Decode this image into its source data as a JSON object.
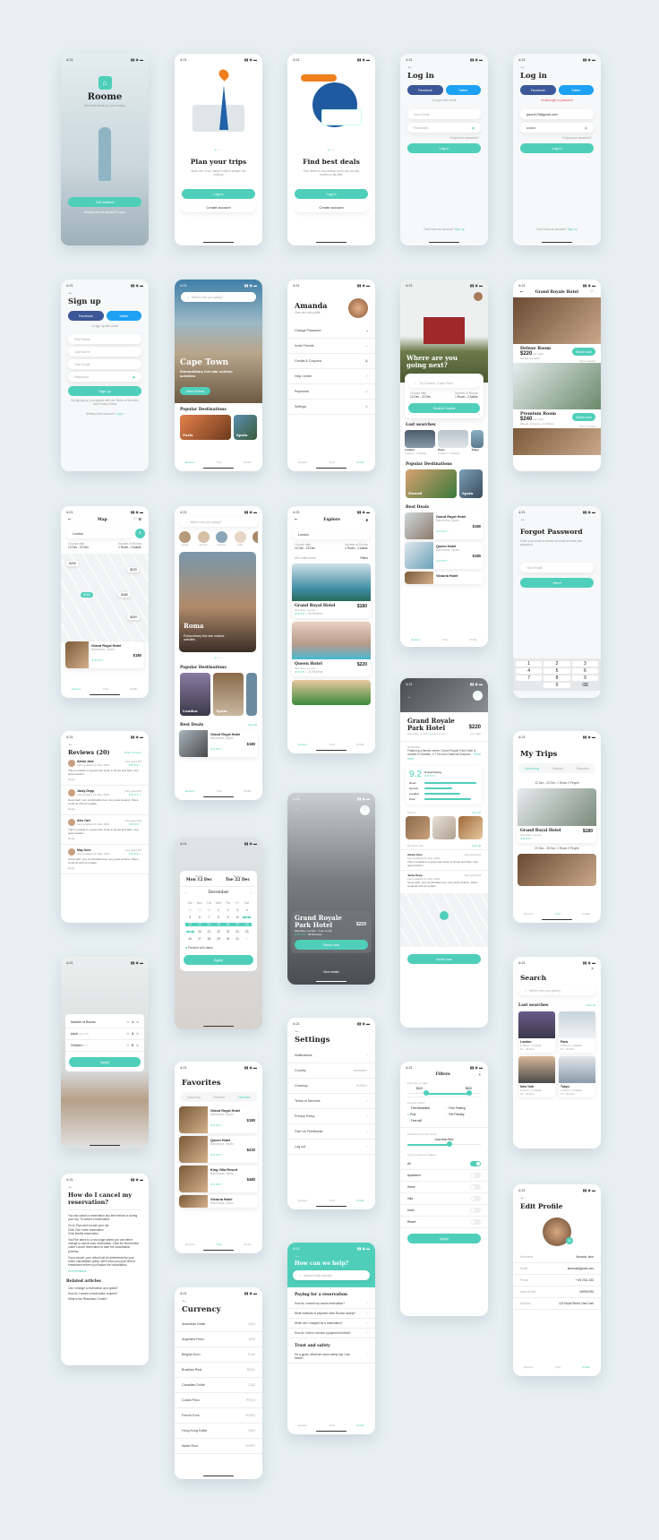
{
  "app": {
    "name": "Roome",
    "tagline": "Best hotel deals for your holiday",
    "status_time": "4:21",
    "accent": "#4fcfba",
    "facebook_color": "#3b5797",
    "twitter_color": "#1da1f2"
  },
  "splash": {
    "title": "Roome",
    "subtitle": "Best hotel deals for your holiday",
    "cta": "Get started",
    "footer": "Already have an account? Log in"
  },
  "onboard1": {
    "title": "Plan your trips",
    "desc": "Book one of our unique hotel to escape the ordinary",
    "login": "Log in",
    "create": "Create account"
  },
  "onboard2": {
    "title": "Find best deals",
    "desc": "Find deals for any season from cosy country homes to city flats",
    "login": "Log in",
    "create": "Create account"
  },
  "login": {
    "title": "Log in",
    "facebook": "Facebook",
    "twitter": "Twitter",
    "or": "or log in with email",
    "email_ph": "Your Email",
    "password_ph": "Password",
    "forgot": "Forgot your password?",
    "submit": "Log in",
    "footer": "Don't have an account?",
    "signup": "Sign up"
  },
  "login_error": {
    "title": "Log in",
    "facebook": "Facebook",
    "twitter": "Twitter",
    "error": "Invalid login or password",
    "email": "jason123@gmail.com",
    "password": "••••••••",
    "forgot": "Forgot your password?",
    "submit": "Log in",
    "footer": "Don't have an account?",
    "signup": "Sign up"
  },
  "signup": {
    "title": "Sign up",
    "facebook": "Facebook",
    "twitter": "Twitter",
    "or": "or sign up with email",
    "first": "First Name",
    "last": "Last Name",
    "email": "Your Email",
    "password": "Password",
    "submit": "Sign up",
    "terms": "By signing up, you agreed with our Terms of Services and Privacy Policy",
    "footer": "Already have account?",
    "login": "Log in"
  },
  "home_cape": {
    "search_ph": "Where are you going?",
    "city": "Cape Town",
    "desc": "Extraordinary five-star outdoor activities",
    "cta": "View Hotels",
    "popular": "Popular Destinations",
    "dest": [
      "Paris",
      "Spain"
    ],
    "nav": [
      "Explore",
      "Trips",
      "Profile"
    ]
  },
  "profile": {
    "name": "Amanda",
    "sub": "View and edit profile",
    "items": [
      "Change Password",
      "Invite Friends",
      "Credits & Coupons",
      "Help Center",
      "Payments",
      "Settings"
    ],
    "nav": [
      "Explore",
      "Trips",
      "Profile"
    ]
  },
  "home_house": {
    "title": "Where are you going next?",
    "search_ph": "Try London, Cape Town",
    "date_label": "Choose date",
    "date": "12 Dec - 22 Dec",
    "rooms_label": "Number of Rooms",
    "rooms": "1 Room - 2 Adults",
    "cta": "Search Hotels",
    "last": "Last searches",
    "searches": [
      {
        "city": "London",
        "info": "1 Room - 2 Adults",
        "dates": "12 - 22 Dec"
      },
      {
        "city": "Paris",
        "info": "1 Room - 2 Adults",
        "dates": "12 - 22 Dec"
      },
      {
        "city": "Tokyo",
        "info": "1 Room",
        "dates": "12 - 22 Dec"
      }
    ],
    "popular": "Popular Destinations",
    "dest": [
      "Hawaii",
      "Spain"
    ],
    "deals": "Best Deals",
    "hotels": [
      {
        "name": "Grand Royal Hotel",
        "loc": "Barcelona, Spain",
        "price": "$180",
        "unit": "per night"
      },
      {
        "name": "Queen Hotel",
        "loc": "Barcelona, Spain",
        "price": "$180",
        "unit": "per night"
      },
      {
        "name": "Victoria Hotel",
        "loc": "Barcelona, Spain"
      }
    ],
    "nav": [
      "Explore",
      "Trips",
      "Profile"
    ]
  },
  "room_list": {
    "title": "Grand Royale Hotel",
    "rooms": [
      {
        "name": "Deluxe Room",
        "price": "$220",
        "unit": "per night",
        "sleeps": "Sleeps 3 people",
        "cta": "Book now",
        "details": "Room details"
      },
      {
        "name": "Premium Room",
        "price": "$240",
        "unit": "per night",
        "sleeps": "Sleeps 4 people + 2 children",
        "cta": "Book now",
        "details": "Room details"
      }
    ]
  },
  "map": {
    "title": "Map",
    "search": "London",
    "date_label": "Choose date",
    "date": "12 Dec - 22 Dec",
    "rooms_label": "Number of Rooms",
    "rooms": "1 Room - 2 Adults",
    "pins": [
      "$200",
      "$220",
      "$180",
      "$180",
      "$200"
    ],
    "card": {
      "name": "Grand Royal Hotel",
      "loc": "Barcelona, Spain",
      "dist": "2 km to city",
      "price": "$180",
      "unit": "per night"
    },
    "nav": [
      "Explore",
      "Trips",
      "Profile"
    ]
  },
  "home_roma": {
    "search_ph": "Where are you going?",
    "cats": [
      "Hotels",
      "Homes",
      "Resorts",
      "Villa",
      "Apartments"
    ],
    "city": "Roma",
    "desc": "Extraordinary five-star outdoor activities",
    "popular": "Popular Destinations",
    "dest": [
      "London",
      "Spain"
    ],
    "deals": "Best Deals",
    "view_all": "View all",
    "hotel": {
      "name": "Grand Royal Hotel",
      "loc": "Barcelona, Spain",
      "dist": "2 km to city",
      "price": "$180",
      "unit": "per night"
    },
    "nav": [
      "Explore",
      "Trips",
      "Profile"
    ]
  },
  "explore": {
    "title": "Explore",
    "search": "London",
    "date_label": "Choose date",
    "date": "12 Dec - 22 Dec",
    "rooms_label": "Number of Rooms",
    "rooms": "1 Room - 2 Adults",
    "found": "530 hotels found",
    "filters": "Filters",
    "hotels": [
      {
        "name": "Grand Royal Hotel",
        "loc": "Wembley, London",
        "dist": "2 km to city",
        "reviews": "80 Reviews",
        "price": "$180",
        "unit": "per night"
      },
      {
        "name": "Queen Hotel",
        "loc": "Wembley, London",
        "dist": "2 km to city",
        "reviews": "80 Reviews",
        "price": "$220",
        "unit": "per night"
      }
    ],
    "nav": [
      "Explore",
      "Trips",
      "Profile"
    ]
  },
  "forgot": {
    "title": "Forgot Password",
    "desc": "Enter your email to receive an email to reset your password",
    "email_ph": "Your Email",
    "submit": "Send",
    "keys": [
      "1",
      "2",
      "3",
      "4",
      "5",
      "6",
      "7",
      "8",
      "9",
      "0"
    ]
  },
  "reviews": {
    "title": "Reviews (20)",
    "write": "Write a review",
    "items": [
      {
        "name": "Alexia Jane",
        "date": "Last updated 21 May, 2019",
        "rating": "Very good 8.0",
        "text": "This is located in a great spot close to shops and bars, very quiet location.",
        "reply": "Reply"
      },
      {
        "name": "Jacky Depp",
        "date": "Last updated 21 May, 2019",
        "rating": "Very good 8.0",
        "text": "Good staff, very comfortable bed, very quiet location. Place could do with an update.",
        "reply": "Reply"
      },
      {
        "name": "Alex Carl",
        "date": "Last updated 21 May, 2019",
        "rating": "Very good 8.0",
        "text": "This is located in a great spot close to shops and bars, very quiet location.",
        "reply": "Reply"
      },
      {
        "name": "May June",
        "date": "Last updated 21 May, 2019",
        "rating": "Very good 8.0",
        "text": "Good staff, very comfortable bed, very quiet location. Place could do with an update.",
        "reply": "Reply"
      }
    ]
  },
  "hotel_detail": {
    "name": "Grand Royale Park Hotel",
    "loc": "Wembley, London",
    "dist": "2 km to city",
    "price": "$220",
    "unit": "per night",
    "summary_label": "Summary",
    "summary": "Featuring a fitness center, Grand Royale Park Hotel is located in Sweden, 4.7 km from National Museum...",
    "read_more": "Read more",
    "score": "9.2",
    "score_label": "Overall Rating",
    "ratings": [
      {
        "label": "Room",
        "value": 0.95
      },
      {
        "label": "Service",
        "value": 0.5
      },
      {
        "label": "Location",
        "value": 0.65
      },
      {
        "label": "Price",
        "value": 0.85
      }
    ],
    "photos": "Photos",
    "view_all": "View all",
    "reviews_label": "Reviews (20)",
    "reviews": [
      {
        "name": "Alexia Jane",
        "date": "Last updated 21 May, 2019",
        "rating": "Very good 8.0",
        "text": "This is located in a great spot close to shops and bars, very quiet location."
      },
      {
        "name": "Jacky Depp",
        "date": "Last updated 21 May, 2019",
        "rating": "Very good 8.0",
        "text": "Good staff, very comfortable bed, very quiet location. Place could do with an update."
      }
    ],
    "cta": "Book now"
  },
  "my_trips": {
    "title": "My Trips",
    "tabs": [
      "Upcoming",
      "Finished",
      "Favorites"
    ],
    "trips": [
      {
        "dates": "12 Dec - 22 Dec, 1 Room 2 People",
        "name": "Grand Royal Hotel",
        "loc": "Wembley, London",
        "price": "$180",
        "unit": "per night"
      },
      {
        "dates": "23 Dec - 26 Dec, 1 Room 2 People"
      }
    ],
    "nav": [
      "Explore",
      "Trips",
      "Profile"
    ]
  },
  "calendar": {
    "depart_label": "Depart",
    "depart": "Mon 12 Dec",
    "return_label": "Return",
    "return": "Tue 22 Dec",
    "month": "December",
    "days": [
      "Sun",
      "Mon",
      "Tue",
      "Wed",
      "Thu",
      "Fri",
      "Sat"
    ],
    "dates": [
      "28",
      "29",
      "30",
      "1",
      "2",
      "3",
      "4",
      "5",
      "6",
      "7",
      "8",
      "9",
      "10",
      "11",
      "12",
      "13",
      "14",
      "15",
      "16",
      "17",
      "18",
      "19",
      "20",
      "21",
      "22",
      "23",
      "24",
      "25",
      "26",
      "27",
      "28",
      "29",
      "30",
      "31",
      "1"
    ],
    "selected_range": [
      13,
      21
    ],
    "flexible": "Flexible with dates",
    "apply": "Apply"
  },
  "hotel_hero": {
    "name": "Grand Royale Park Hotel",
    "loc": "Wembley, London",
    "dist": "2 km to city",
    "reviews": "80 Reviews",
    "price": "$220",
    "unit": "per night",
    "cta": "Book now",
    "more": "More details"
  },
  "guests": {
    "rows": [
      {
        "label": "Number of Rooms",
        "hint": "",
        "value": "1"
      },
      {
        "label": "Adult",
        "hint": "Aged 18+",
        "value": "2"
      },
      {
        "label": "Children",
        "hint": "0-17",
        "value": "0"
      }
    ],
    "apply": "Apply"
  },
  "settings": {
    "title": "Settings",
    "items": [
      {
        "label": "Notifications",
        "value": ""
      },
      {
        "label": "Country",
        "value": "Australia"
      },
      {
        "label": "Currency",
        "value": "$ AUD"
      },
      {
        "label": "Terms of Services",
        "value": ""
      },
      {
        "label": "Privacy Policy",
        "value": ""
      },
      {
        "label": "Give Us Feedbacks",
        "value": ""
      },
      {
        "label": "Log out",
        "value": ""
      }
    ],
    "nav": [
      "Explore",
      "Trips",
      "Profile"
    ]
  },
  "search": {
    "title": "Search",
    "search_ph": "Where are you going?",
    "last": "Last searches",
    "clear": "Clear all",
    "items": [
      {
        "city": "London",
        "info": "1 Room - 2 Adults",
        "dates": "12 - 22 Dec"
      },
      {
        "city": "Paris",
        "info": "1 Room - 2 Adults",
        "dates": "12 - 22 Dec"
      },
      {
        "city": "New York",
        "info": "1 Room - 2 Adults",
        "dates": "12 - 22 Dec"
      },
      {
        "city": "Tokyo",
        "info": "1 Room - 2 Adults",
        "dates": "12 - 22 Dec"
      }
    ]
  },
  "favorites": {
    "title": "Favorites",
    "tabs": [
      "Upcoming",
      "Finished",
      "Favorites"
    ],
    "hotels": [
      {
        "name": "Grand Royal Hotel",
        "loc": "Barcelona, Spain",
        "price": "$180",
        "unit": "per night"
      },
      {
        "name": "Queen Hotel",
        "loc": "Barcelona, Spain",
        "price": "$220",
        "unit": "per night"
      },
      {
        "name": "King Villa Resort",
        "loc": "Barcelona, Spain",
        "price": "$480",
        "unit": "per night"
      },
      {
        "name": "Victoria Hotel",
        "loc": "Barcelona, Spain"
      }
    ],
    "nav": [
      "Explore",
      "Trips",
      "Profile"
    ]
  },
  "filters": {
    "title": "Filters",
    "price_label": "Price (for 1 night)",
    "price_min": "$100",
    "price_max": "$600",
    "popular_label": "Popular Filters",
    "options": [
      {
        "label": "Free Breakfast",
        "checked": false
      },
      {
        "label": "Free Parking",
        "checked": false
      },
      {
        "label": "Pool",
        "checked": true
      },
      {
        "label": "Pet Friendly",
        "checked": false
      },
      {
        "label": "Free wifi",
        "checked": false
      }
    ],
    "distance_label": "Distance from city centre",
    "distance": "Less than 5km",
    "type_label": "Type of Accommodation",
    "types": [
      {
        "label": "All",
        "on": true
      },
      {
        "label": "Apartment",
        "on": false
      },
      {
        "label": "Home",
        "on": false
      },
      {
        "label": "Villa",
        "on": false
      },
      {
        "label": "Hotel",
        "on": false
      },
      {
        "label": "Resort",
        "on": false
      }
    ],
    "apply": "Apply"
  },
  "help_article": {
    "title": "How do I cancel my reservation?",
    "p1": "You can cancel a reservation any time before or during your trip. To cancel a reservation:",
    "steps": [
      "Go to Trips and choose your trip",
      "Click Your home reservation",
      "Click Modify reservation"
    ],
    "p2": "You'll be taken to a new page where you can either change or cancel your reservation. Click the Next button under Cancel reservation to start the cancellation process.",
    "p3": "If you cancel, your refund will be determined by your host's cancellation policy. We'll show you your refund breakdown before you finalize the cancellation.",
    "feedback": "Give feedback",
    "related": "Related articles",
    "articles": [
      "Can I change a reservation as a guest?",
      "How do I cancel a reservation request?",
      "What is the Resolution Center?"
    ]
  },
  "help_center": {
    "title": "How can we help?",
    "search_ph": "Search help articles",
    "sec1": "Paying for a reservation",
    "q1": [
      "How do I cancel my rooms reservation?",
      "What methods of payment does Roome accept?",
      "When am I charged for a reservation?",
      "How do I edit or remove a payment method?"
    ],
    "sec2": "Trust and safety",
    "q2": [
      "I'm a guest. What are some safety tips I can follow?"
    ],
    "nav": [
      "Explore",
      "Trips",
      "Profile"
    ]
  },
  "edit_profile": {
    "title": "Edit Profile",
    "fields": [
      {
        "label": "Username",
        "value": "Amanda Jane"
      },
      {
        "label": "Email",
        "value": "amanda@gmail.com"
      },
      {
        "label": "Phone",
        "value": "+ 65 2311 333"
      },
      {
        "label": "Date of birth",
        "value": "20/05/1990"
      },
      {
        "label": "Address",
        "value": "123 Royal Street, New York"
      }
    ],
    "nav": [
      "Explore",
      "Trips",
      "Profile"
    ]
  },
  "currency": {
    "title": "Currency",
    "items": [
      {
        "name": "Australian Dollar",
        "code": "AUD"
      },
      {
        "name": "Argentine Peso",
        "code": "ARS"
      },
      {
        "name": "Belgian Euro",
        "code": "Euro"
      },
      {
        "name": "Brazilian Real",
        "code": "REAL"
      },
      {
        "name": "Canadian Dollar",
        "code": "CAD"
      },
      {
        "name": "Cuban Peso",
        "code": "PESO"
      },
      {
        "name": "French Euro",
        "code": "EURO"
      },
      {
        "name": "Hong Kong Dollar",
        "code": "HKD"
      },
      {
        "name": "Italian Euro",
        "code": "EURO"
      }
    ]
  }
}
